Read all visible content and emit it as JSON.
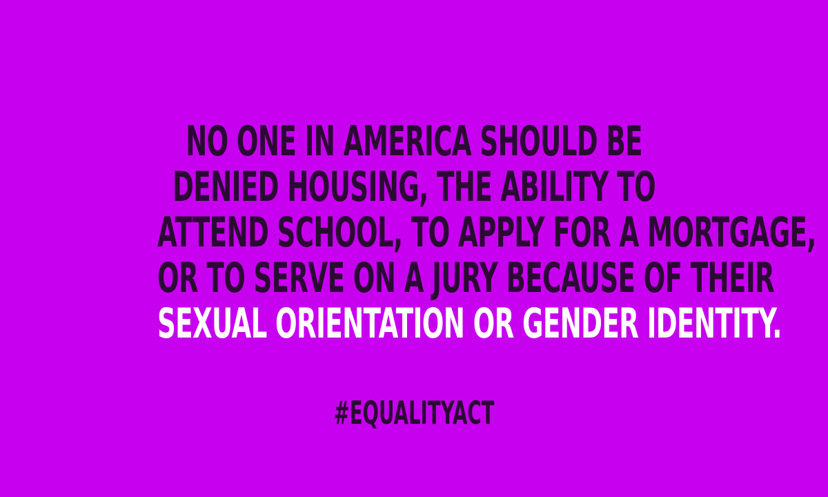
{
  "colors": {
    "background": "#c800f0",
    "text_dark": "#2a0a33",
    "text_highlight": "#ffffff"
  },
  "quote": {
    "lines": [
      "NO ONE IN AMERICA SHOULD BE",
      "DENIED HOUSING, THE ABILITY TO",
      "ATTEND SCHOOL, TO APPLY FOR A MORTGAGE,",
      "OR TO SERVE ON A JURY BECAUSE OF THEIR"
    ],
    "highlight": "SEXUAL ORIENTATION OR GENDER IDENTITY."
  },
  "hashtag": "#EQUALITYACT"
}
